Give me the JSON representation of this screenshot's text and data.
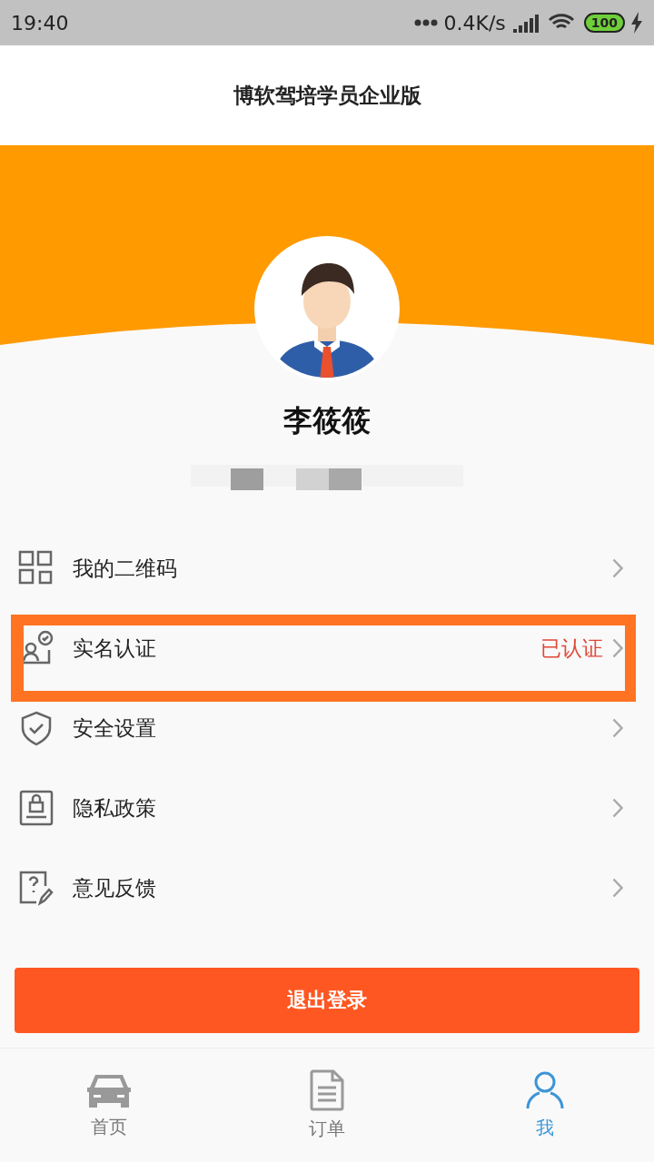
{
  "status_bar": {
    "time": "19:40",
    "speed": "0.4K/s",
    "battery": "100"
  },
  "title": "博软驾培学员企业版",
  "profile": {
    "name": "李筱筱"
  },
  "menu": [
    {
      "kind": "qrcode",
      "label": "我的二维码",
      "highlighted": false
    },
    {
      "kind": "idcard",
      "label": "实名认证",
      "status": "已认证",
      "highlighted": true
    },
    {
      "kind": "shield",
      "label": "安全设置",
      "highlighted": false
    },
    {
      "kind": "lock",
      "label": "隐私政策",
      "highlighted": false
    },
    {
      "kind": "feedback",
      "label": "意见反馈",
      "highlighted": false
    }
  ],
  "logout_button": "退出登录",
  "tabs": [
    {
      "kind": "car",
      "label": "首页",
      "selected": false
    },
    {
      "kind": "document",
      "label": "订单",
      "selected": false
    },
    {
      "kind": "person",
      "label": "我",
      "selected": true
    }
  ]
}
